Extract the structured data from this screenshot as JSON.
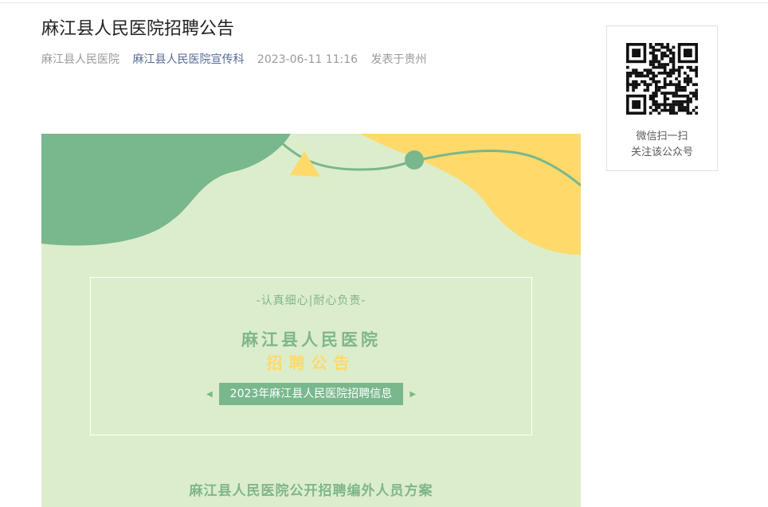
{
  "article": {
    "title": "麻江县人民医院招聘公告",
    "meta": {
      "author": "麻江县人民医院",
      "account": "麻江县人民医院宣传科",
      "datetime": "2023-06-11 11:16",
      "location": "发表于贵州"
    }
  },
  "banner": {
    "slogan": "-认真细心|耐心负责-",
    "hospital_name": "麻江县人民医院",
    "notice_word": "招聘公告",
    "pill_text": "2023年麻江县人民医院招聘信息",
    "bottom_title": "麻江县人民医院公开招聘编外人员方案",
    "colors": {
      "background": "#dcedcb",
      "green": "#79b78c",
      "yellow": "#ffd96a"
    }
  },
  "qr": {
    "line1": "微信扫一扫",
    "line2": "关注该公众号"
  },
  "icons": {
    "left_arrow": "◀",
    "right_arrow": "▶"
  }
}
